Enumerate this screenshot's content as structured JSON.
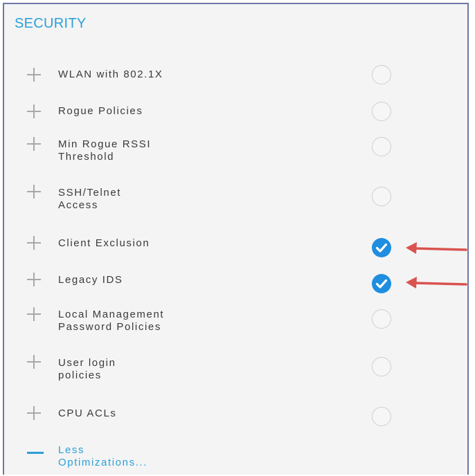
{
  "panel": {
    "title": "SECURITY"
  },
  "optimizations": [
    {
      "label": "WLAN with 802.1X",
      "checked": false
    },
    {
      "label": "Rogue Policies",
      "checked": false
    },
    {
      "label": "Min Rogue RSSI\nThreshold",
      "checked": false
    },
    {
      "label": "SSH/Telnet\nAccess",
      "checked": false
    },
    {
      "label": "Client Exclusion",
      "checked": true
    },
    {
      "label": "Legacy IDS",
      "checked": true
    },
    {
      "label": "Local Management\nPassword Policies",
      "checked": false
    },
    {
      "label": "User login\npolicies",
      "checked": false
    },
    {
      "label": "CPU ACLs",
      "checked": false
    }
  ],
  "less_optimizations": {
    "label": "Less Optimizations..."
  },
  "colors": {
    "accent": "#2aa0d8",
    "checked": "#1f8ee0",
    "arrow": "#d9534f"
  }
}
